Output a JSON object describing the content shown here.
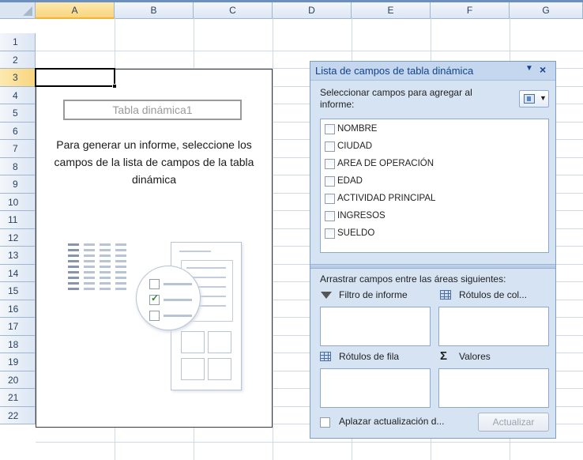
{
  "spreadsheet": {
    "columns": [
      "A",
      "B",
      "C",
      "D",
      "E",
      "F",
      "G"
    ],
    "rows": [
      "1",
      "2",
      "3",
      "4",
      "5",
      "6",
      "7",
      "8",
      "9",
      "10",
      "11",
      "12",
      "13",
      "14",
      "15",
      "16",
      "17",
      "18",
      "19",
      "20",
      "21",
      "22"
    ],
    "active_column": "A",
    "active_row": "3"
  },
  "pivot": {
    "name": "Tabla dinámica1",
    "instructions": "Para generar un informe, seleccione los campos de la lista de campos de la tabla dinámica"
  },
  "field_pane": {
    "title": "Lista de campos de tabla dinámica",
    "menu_icon": "triangle-down-icon",
    "close_icon": "close-icon",
    "select_label": "Seleccionar campos para agregar al informe:",
    "fields": [
      "NOMBRE",
      "CIUDAD",
      "AREA DE OPERACIÓN",
      "EDAD",
      "ACTIVIDAD PRINCIPAL",
      "INGRESOS",
      "SUELDO"
    ],
    "areas_label": "Arrastrar campos entre las áreas siguientes:",
    "areas": {
      "report_filter": "Filtro de informe",
      "column_labels": "Rótulos de col...",
      "row_labels": "Rótulos de fila",
      "values": "Valores"
    },
    "defer_label": "Aplazar actualización d...",
    "update_button": "Actualizar"
  },
  "colors": {
    "pane_bg": "#d6e3f3",
    "header_bg": "#dce6f4",
    "active_header": "#f9d57e",
    "title_text": "#15428b"
  }
}
